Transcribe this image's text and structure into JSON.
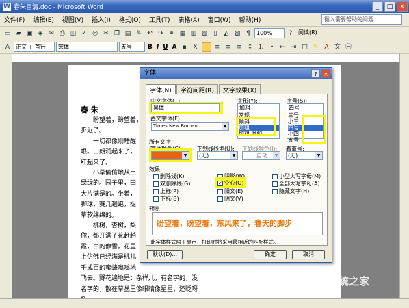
{
  "window": {
    "title": "春朱自清.doc - Microsoft Word"
  },
  "menu": [
    "文件(F)",
    "编辑(E)",
    "视图(V)",
    "插入(I)",
    "格式(O)",
    "工具(T)",
    "表格(A)",
    "窗口(W)",
    "帮助(H)"
  ],
  "help_placeholder": "键入需要帮助的问题",
  "toolbar1": {
    "zoom": "100%",
    "reading": "阅读(R)"
  },
  "toolbar2": {
    "style": "正文 + 首行",
    "font": "宋体",
    "size": "五号",
    "bold": "B",
    "italic": "I",
    "underline": "U",
    "char": "A"
  },
  "document": {
    "title": "春 朱",
    "paragraphs": [
      "盼望着，盼望着，",
      "步近了。",
      "一切都像刚睡醒",
      "眼。山朗润起来了，",
      "红起来了。",
      "小草偷偷地从土",
      "绿绿的。园子里，田",
      "大片满是的。坐着，",
      "脚球，赛几趟跑，捉",
      "草软绵绵的。",
      "桃树，杏树，梨",
      "你，都开满了花赶趟",
      "霞，白的像雪。花里",
      "上仿佛已经满是桃儿",
      "千成百的蜜蜂嗡嗡地",
      "飞去。野花遍地是：杂样儿，有名字的，没",
      "名字的，散在草丛里像眼睛像星星，还眨呀",
      "眨。"
    ]
  },
  "dialog": {
    "title": "字体",
    "help_btn": "?",
    "close_btn": "×",
    "tabs": [
      "字体(N)",
      "字符间距(R)",
      "文字效果(X)"
    ],
    "chinese_font_label": "中文字体(T):",
    "chinese_font_value": "黑体",
    "western_font_label": "西文字体(F):",
    "western_font_value": "Times New Roman",
    "style_label": "字形(Y):",
    "style_value": "加粗",
    "style_options": [
      "常规",
      "倾斜",
      "加粗",
      "加粗 倾斜"
    ],
    "size_label": "字号(S):",
    "size_value": "四号",
    "size_options": [
      "三号",
      "小三",
      "四号",
      "小四",
      "五号"
    ],
    "all_text_label": "所有文字",
    "font_color_label": "字体颜色(C):",
    "font_color_value": "#e8630f",
    "underline_label": "下划线线型(U):",
    "underline_value": "(无)",
    "underline_color_label": "下划线颜色(I):",
    "underline_color_value": "自动",
    "emphasis_label": "着重号:",
    "emphasis_value": "(无)",
    "effects_label": "效果",
    "effects": [
      {
        "label": "删除线(K)",
        "checked": false
      },
      {
        "label": "双删除线(G)",
        "checked": false
      },
      {
        "label": "上标(P)",
        "checked": false
      },
      {
        "label": "下标(B)",
        "checked": false
      },
      {
        "label": "阴影(W)",
        "checked": false
      },
      {
        "label": "空心(O)",
        "checked": true
      },
      {
        "label": "阳文(E)",
        "checked": false
      },
      {
        "label": "阴文(V)",
        "checked": false
      },
      {
        "label": "小型大写字母(M)",
        "checked": false
      },
      {
        "label": "全部大写字母(A)",
        "checked": false
      },
      {
        "label": "隐藏文字(H)",
        "checked": false
      }
    ],
    "preview_label": "预览",
    "preview_text": "盼望着，盼望着，东风来了，春天的脚步",
    "note": "此字体样式限于显示，打印时将采用最相近的匹配样式。",
    "default_btn": "默认(D)...",
    "ok_btn": "确定",
    "cancel_btn": "取消"
  },
  "watermark": "系统之家"
}
